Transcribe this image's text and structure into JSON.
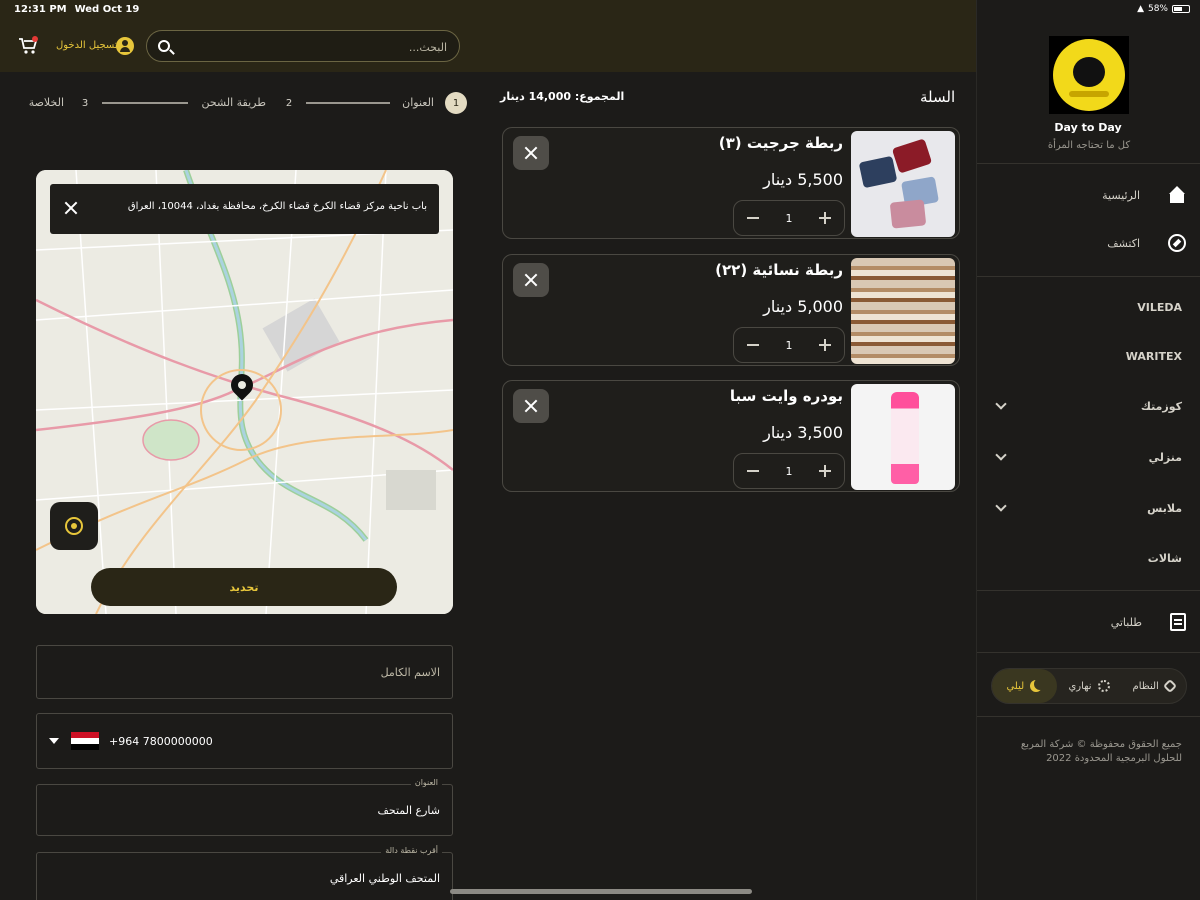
{
  "status_bar": {
    "time": "12:31 PM",
    "date": "Wed Oct 19",
    "battery": "58%"
  },
  "header": {
    "search_placeholder": "البحث...",
    "login_label": "تسجيل الدخول"
  },
  "sidebar": {
    "brand": "Day to Day",
    "tagline": "كل ما تحتاجه المرأة",
    "nav": [
      {
        "label": "الرئيسية",
        "icon": "home-icon"
      },
      {
        "label": "اكتشف",
        "icon": "compass-icon"
      }
    ],
    "categories": [
      {
        "label": "VILEDA",
        "expandable": false
      },
      {
        "label": "WARITEX",
        "expandable": false
      },
      {
        "label": "كوزمتك",
        "expandable": true
      },
      {
        "label": "منزلي",
        "expandable": true
      },
      {
        "label": "ملابس",
        "expandable": true
      },
      {
        "label": "شالات",
        "expandable": false
      }
    ],
    "orders_label": "طلباتي",
    "theme": {
      "system": "النظام",
      "light": "نهاري",
      "dark": "ليلي",
      "selected": "dark"
    },
    "copyright": "جميع الحقوق محفوظة © شركة المربع للحلول البرمجية المحدودة 2022"
  },
  "cart": {
    "title": "السلة",
    "total_label": "المجموع:",
    "total_value": "14,000 دينار",
    "items": [
      {
        "name": "ربطة جرجيت (٣)",
        "price": "5,500 دينار",
        "qty": "1"
      },
      {
        "name": "ربطة نسائية (٢٢)",
        "price": "5,000 دينار",
        "qty": "1"
      },
      {
        "name": "بودره وايت سبا",
        "price": "3,500 دينار",
        "qty": "1"
      }
    ]
  },
  "checkout": {
    "steps": [
      {
        "num": "1",
        "label": "العنوان",
        "active": true
      },
      {
        "num": "2",
        "label": "طريقة الشحن",
        "active": false
      },
      {
        "num": "3",
        "label": "الخلاصة",
        "active": false
      }
    ],
    "map": {
      "address": "باب ناحية مركز قضاء الكرخ قضاء الكرخ، محافظة بغداد، 10044، العراق",
      "confirm_label": "تحديد"
    },
    "form": {
      "fullname_placeholder": "الاسم الكامل",
      "phone_value": "+964 7800000000",
      "address_label": "العنوان",
      "address_value": "شارع المتحف",
      "landmark_label": "أقرب نقطة دالة",
      "landmark_value": "المتحف الوطني العراقي"
    }
  },
  "colors": {
    "accent": "#e7c63b",
    "topbar": "#2a2616",
    "background": "#1c1b19"
  }
}
